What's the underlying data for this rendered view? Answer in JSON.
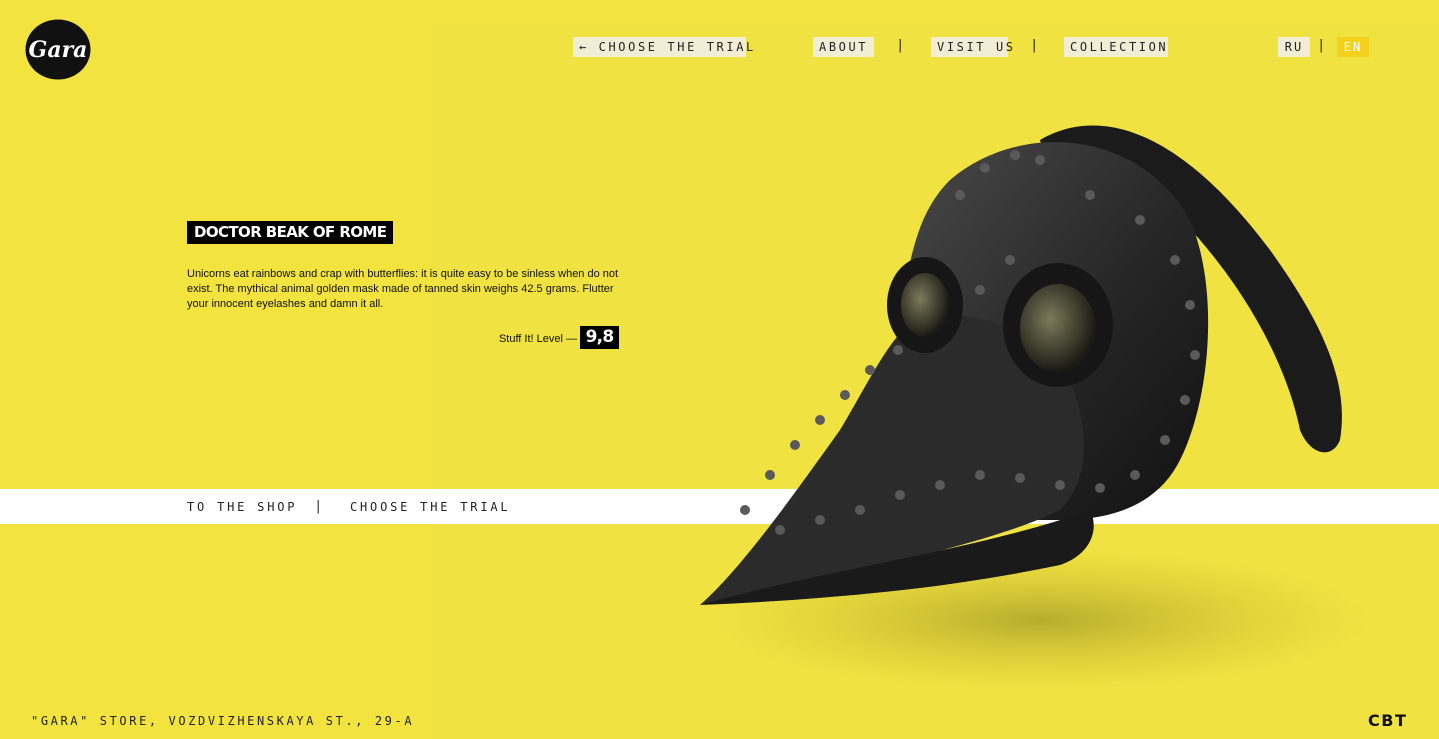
{
  "brand": {
    "logo_text": "Gara"
  },
  "nav": {
    "back_label": "← CHOOSE THE TRIAL",
    "about_label": "ABOUT",
    "visit_label": "VISIT US",
    "collection_label": "COLLECTION",
    "separator": "|"
  },
  "lang": {
    "ru": "RU",
    "en": "EN",
    "active": "EN"
  },
  "product": {
    "title": "DOCTOR BEAK OF ROME",
    "description": "Unicorns eat rainbows and crap with butterflies: it is quite easy to be sinless when do not exist. The mythical animal golden mask made of tanned skin weighs 42.5 grams. Flutter your innocent eyelashes and damn it all.",
    "level_label": "Stuff It! Level —",
    "level_value": "9,8",
    "image_icon": "plague-doctor-mask-image"
  },
  "shop_bar": {
    "shop_label": "TO THE SHOP",
    "trial_label": "CHOOSE THE TRIAL",
    "separator": "|"
  },
  "footer": {
    "address": "\"GARA\" STORE, VOZDVIZHENSKAYA ST., 29-A",
    "brand": "CBT"
  },
  "colors": {
    "background": "#f2e33e",
    "accent": "#f4d21a",
    "text": "#111111",
    "bar": "#ffffff"
  }
}
